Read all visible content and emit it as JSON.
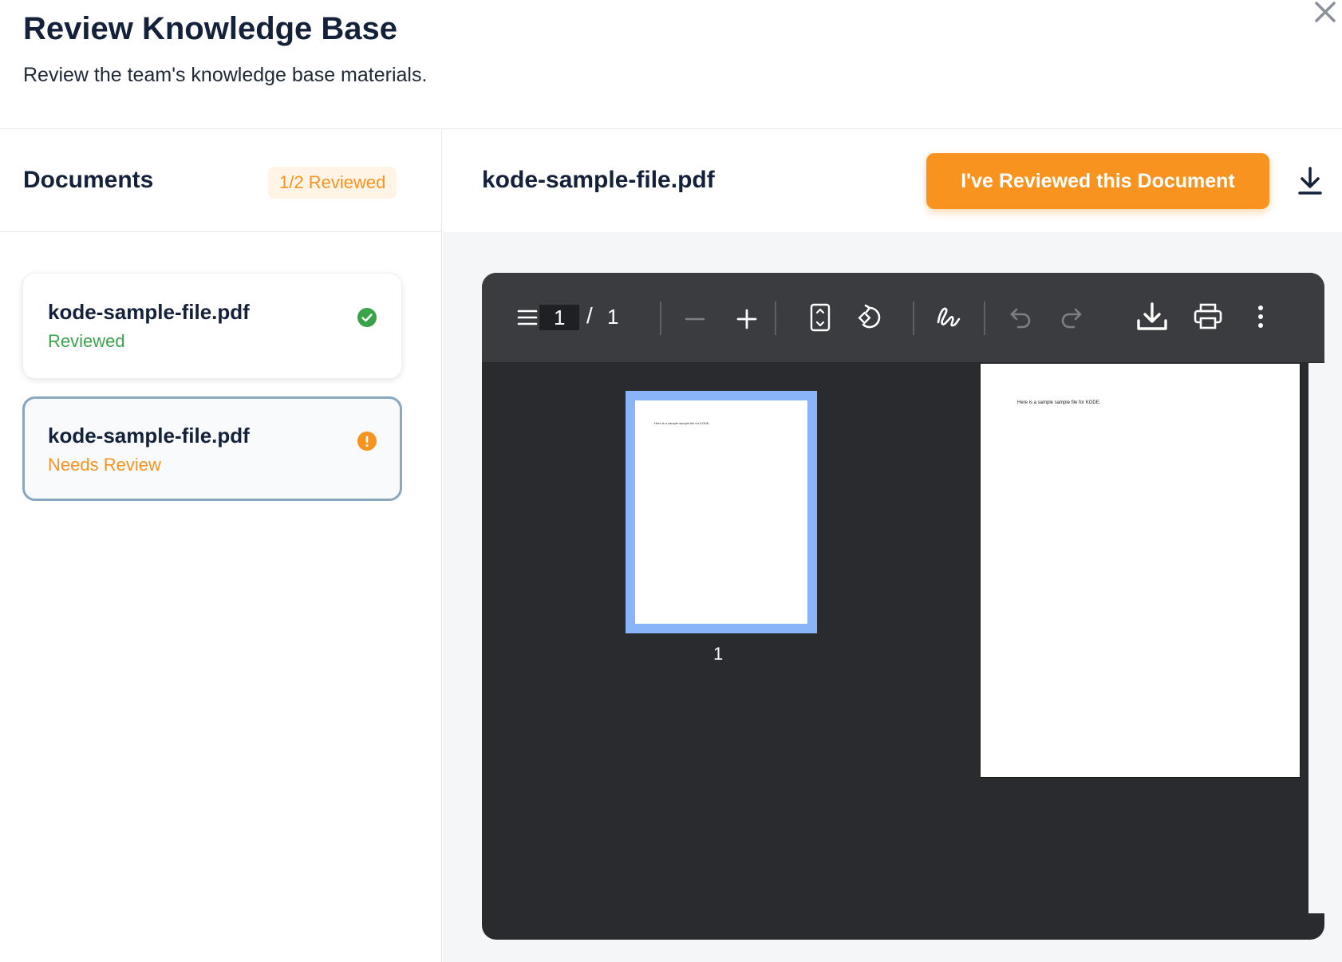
{
  "header": {
    "title": "Review Knowledge Base",
    "subtitle": "Review the team's knowledge base materials."
  },
  "sidebar": {
    "title": "Documents",
    "badge": "1/2 Reviewed",
    "documents": [
      {
        "name": "kode-sample-file.pdf",
        "status": "Reviewed",
        "icon": "check-circle-icon",
        "color": "#3aa34a"
      },
      {
        "name": "kode-sample-file.pdf",
        "status": "Needs Review",
        "icon": "alert-circle-icon",
        "color": "#f7931e"
      }
    ]
  },
  "main": {
    "document_title": "kode-sample-file.pdf",
    "review_button_label": "I've Reviewed this Document"
  },
  "viewer": {
    "current_page": "1",
    "separator": "/",
    "total_pages": "1",
    "thumbnail_label": "1",
    "page_text": "Here is a sample sample file for KODE."
  },
  "colors": {
    "accent": "#f7931e",
    "success": "#3aa34a",
    "viewer_bg": "#2a2b2e",
    "toolbar_bg": "#3b3c3f",
    "thumb_highlight": "#8ab4f8"
  }
}
